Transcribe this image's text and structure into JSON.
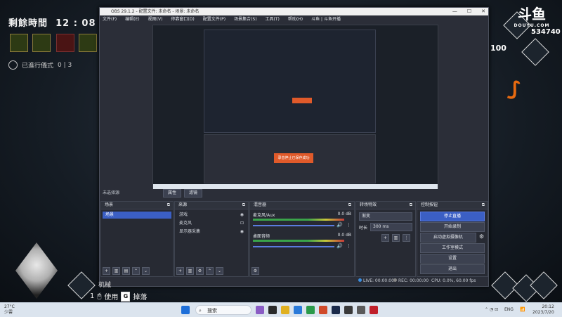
{
  "hud": {
    "time_label": "剩餘時間",
    "time_value": "12 : 08",
    "tasks_label": "已進行儀式",
    "tasks_value": "0 | 3",
    "score": "534740",
    "score_left": "100",
    "brand": "斗鱼",
    "brand_sub": "DOUYU.COM",
    "hint_use": "使用",
    "hint_drop": "掉落",
    "hint_key": "G",
    "hint_count": "1",
    "char_name": "机械"
  },
  "obs": {
    "title": "OBS 29.1.2 - 配置文件: 未命名 - 场景: 未命名",
    "menu": [
      "文件(F)",
      "编辑(E)",
      "视图(V)",
      "停靠窗口(D)",
      "配置文件(P)",
      "场景集合(S)",
      "工具(T)",
      "帮助(H)",
      "斗鱼 | 斗鱼开播"
    ],
    "status_text": "未选择源",
    "tabs": [
      "属性",
      "滤镜"
    ],
    "toast": "录音停止已保存成功",
    "docks": {
      "scenes": {
        "title": "场景",
        "items": [
          "场景"
        ]
      },
      "sources": {
        "title": "来源",
        "items": [
          "游戏",
          "麦克风",
          "显示器采集"
        ]
      },
      "mixer": {
        "title": "混音器",
        "channels": [
          {
            "name": "麦克风/Aux",
            "db": "0.0 dB"
          },
          {
            "name": "桌面音频",
            "db": "0.0 dB"
          }
        ]
      },
      "transitions": {
        "title": "转场特效",
        "type": "渐变",
        "duration_label": "时长",
        "duration_value": "300 ms"
      },
      "controls": {
        "title": "控制按钮",
        "buttons": [
          "停止直播",
          "开始录制",
          "启动虚拟摄像机",
          "工作室模式",
          "设置",
          "退出"
        ]
      }
    },
    "bottom": {
      "live": "LIVE: 00:00:00",
      "rec": "REC: 00:00:00",
      "cpu": "CPU: 0.0%, 60.00 fps"
    }
  },
  "taskbar": {
    "weather_temp": "27°C",
    "weather_desc": "少雲",
    "search_placeholder": "搜索",
    "lang": "ENG",
    "time": "20:12",
    "date": "2023/7/20"
  }
}
